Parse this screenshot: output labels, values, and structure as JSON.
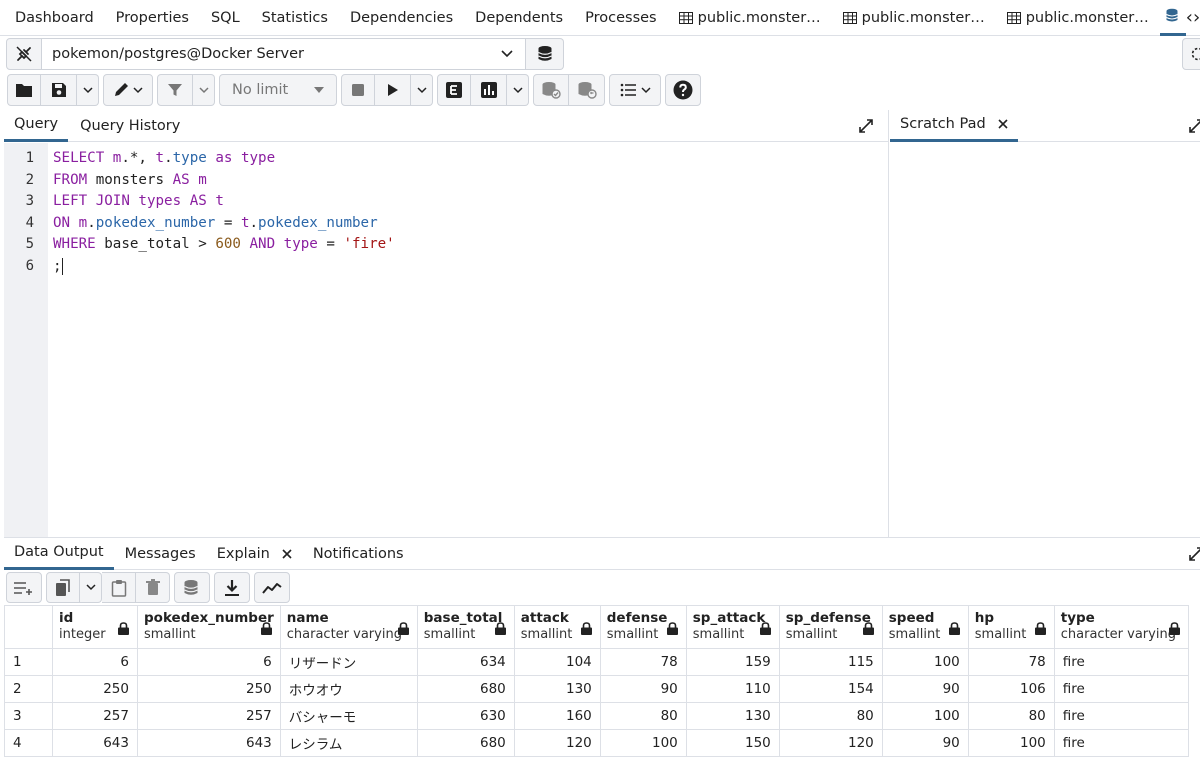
{
  "top_tabs": [
    "Dashboard",
    "Properties",
    "SQL",
    "Statistics",
    "Dependencies",
    "Dependents",
    "Processes",
    "public.monster…",
    "public.monster…",
    "public.monster…"
  ],
  "connection": {
    "label": "pokemon/postgres@Docker Server"
  },
  "toolbar": {
    "limit_label": "No limit"
  },
  "query_tabs": {
    "query": "Query",
    "history": "Query History"
  },
  "scratch": {
    "label": "Scratch Pad"
  },
  "editor": {
    "line_numbers": [
      "1",
      "2",
      "3",
      "4",
      "5",
      "6"
    ]
  },
  "output_tabs": {
    "data_output": "Data Output",
    "messages": "Messages",
    "explain": "Explain",
    "notifications": "Notifications"
  },
  "table": {
    "columns": [
      {
        "name": "id",
        "type": "integer"
      },
      {
        "name": "pokedex_number",
        "type": "smallint"
      },
      {
        "name": "name",
        "type": "character varying"
      },
      {
        "name": "base_total",
        "type": "smallint"
      },
      {
        "name": "attack",
        "type": "smallint"
      },
      {
        "name": "defense",
        "type": "smallint"
      },
      {
        "name": "sp_attack",
        "type": "smallint"
      },
      {
        "name": "sp_defense",
        "type": "smallint"
      },
      {
        "name": "speed",
        "type": "smallint"
      },
      {
        "name": "hp",
        "type": "smallint"
      },
      {
        "name": "type",
        "type": "character varying"
      }
    ],
    "rows": [
      [
        "1",
        "6",
        "6",
        "リザードン",
        "634",
        "104",
        "78",
        "159",
        "115",
        "100",
        "78",
        "fire"
      ],
      [
        "2",
        "250",
        "250",
        "ホウオウ",
        "680",
        "130",
        "90",
        "110",
        "154",
        "90",
        "106",
        "fire"
      ],
      [
        "3",
        "257",
        "257",
        "バシャーモ",
        "630",
        "160",
        "80",
        "130",
        "80",
        "100",
        "80",
        "fire"
      ],
      [
        "4",
        "643",
        "643",
        "レシラム",
        "680",
        "120",
        "100",
        "150",
        "120",
        "90",
        "100",
        "fire"
      ]
    ]
  }
}
